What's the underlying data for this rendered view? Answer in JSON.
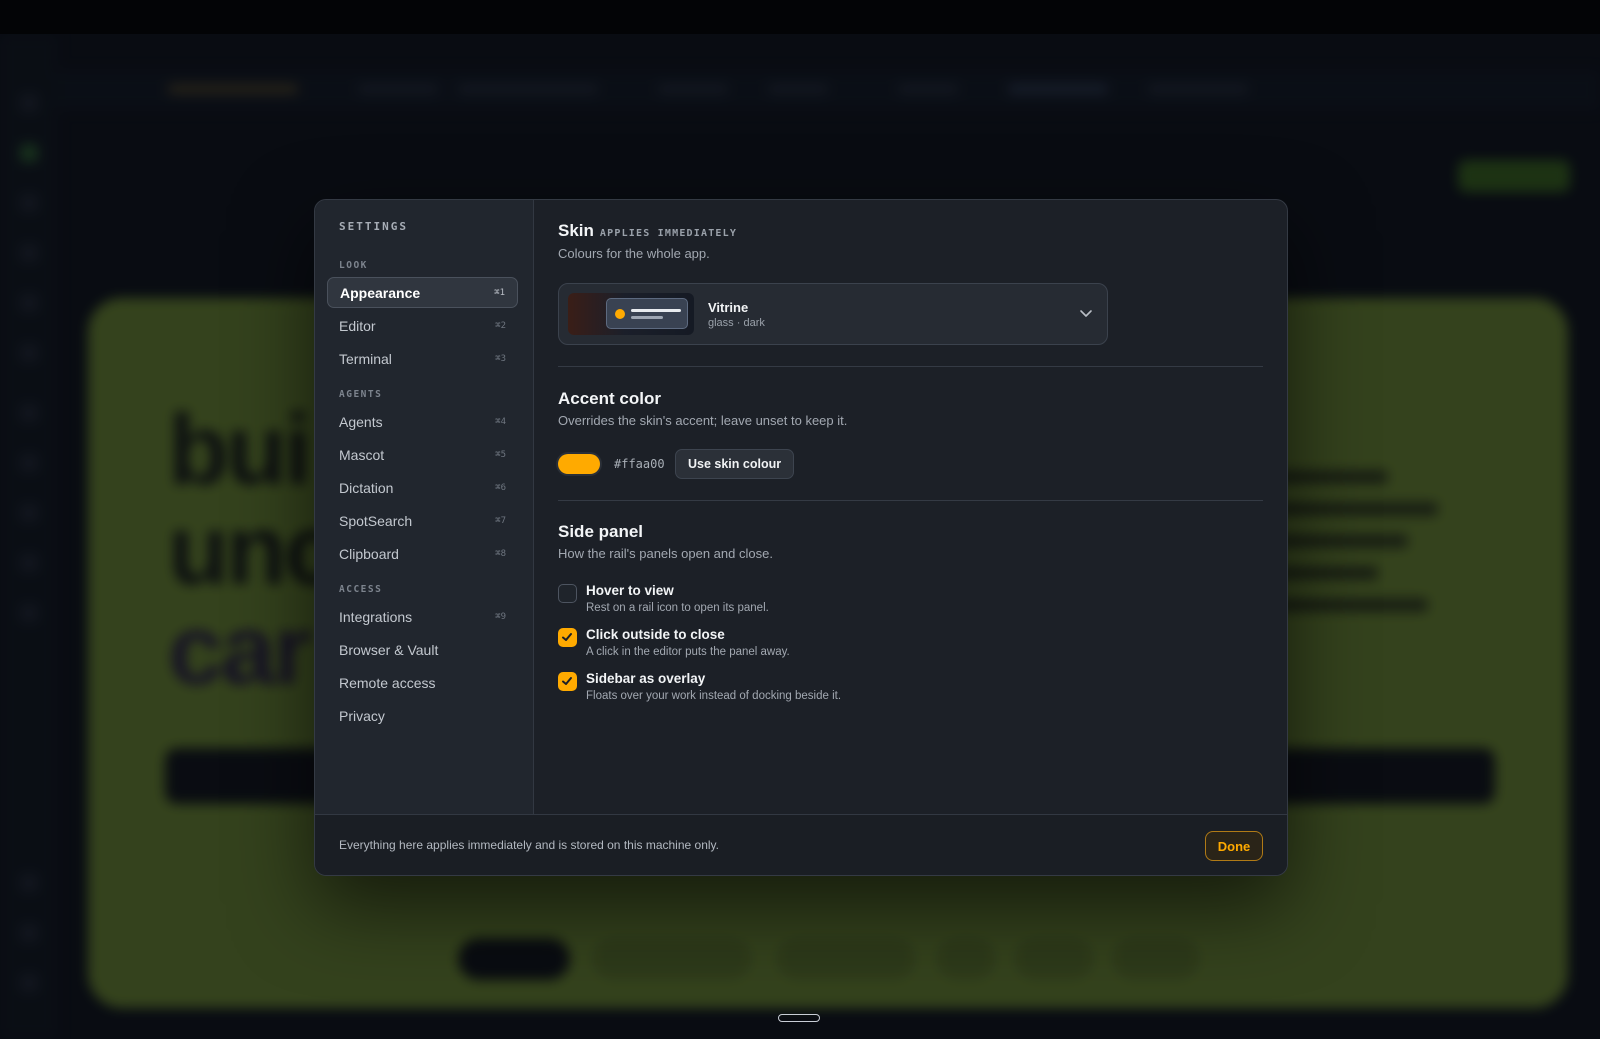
{
  "settings": {
    "title": "SETTINGS",
    "groups": {
      "look": "LOOK",
      "agents": "AGENTS",
      "access": "ACCESS"
    },
    "nav": [
      {
        "label": "Appearance",
        "shortcut": "⌘1",
        "active": true
      },
      {
        "label": "Editor",
        "shortcut": "⌘2"
      },
      {
        "label": "Terminal",
        "shortcut": "⌘3"
      },
      {
        "label": "Agents",
        "shortcut": "⌘4"
      },
      {
        "label": "Mascot",
        "shortcut": "⌘5"
      },
      {
        "label": "Dictation",
        "shortcut": "⌘6"
      },
      {
        "label": "SpotSearch",
        "shortcut": "⌘7"
      },
      {
        "label": "Clipboard",
        "shortcut": "⌘8"
      },
      {
        "label": "Integrations",
        "shortcut": "⌘9"
      },
      {
        "label": "Browser & Vault",
        "shortcut": ""
      },
      {
        "label": "Remote access",
        "shortcut": ""
      },
      {
        "label": "Privacy",
        "shortcut": ""
      }
    ]
  },
  "skin": {
    "heading": "Skin",
    "tag": "APPLIES IMMEDIATELY",
    "description": "Colours for the whole app.",
    "selected_name": "Vitrine",
    "selected_meta": "glass · dark"
  },
  "accent": {
    "heading": "Accent color",
    "description": "Overrides the skin's accent; leave unset to keep it.",
    "value": "#ffaa00",
    "reset_label": "Use skin colour"
  },
  "side_panel": {
    "heading": "Side panel",
    "description": "How the rail's panels open and close.",
    "options": [
      {
        "title": "Hover to view",
        "desc": "Rest on a rail icon to open its panel.",
        "checked": false
      },
      {
        "title": "Click outside to close",
        "desc": "A click in the editor puts the panel away.",
        "checked": true
      },
      {
        "title": "Sidebar as overlay",
        "desc": "Floats over your work instead of docking beside it.",
        "checked": true
      }
    ]
  },
  "footer": {
    "note": "Everything here applies immediately and is stored on this machine only.",
    "done_label": "Done"
  },
  "colors": {
    "accent": "#ffaa00",
    "modal_bg": "#1c2027",
    "sidebar_bg": "#21262e"
  }
}
